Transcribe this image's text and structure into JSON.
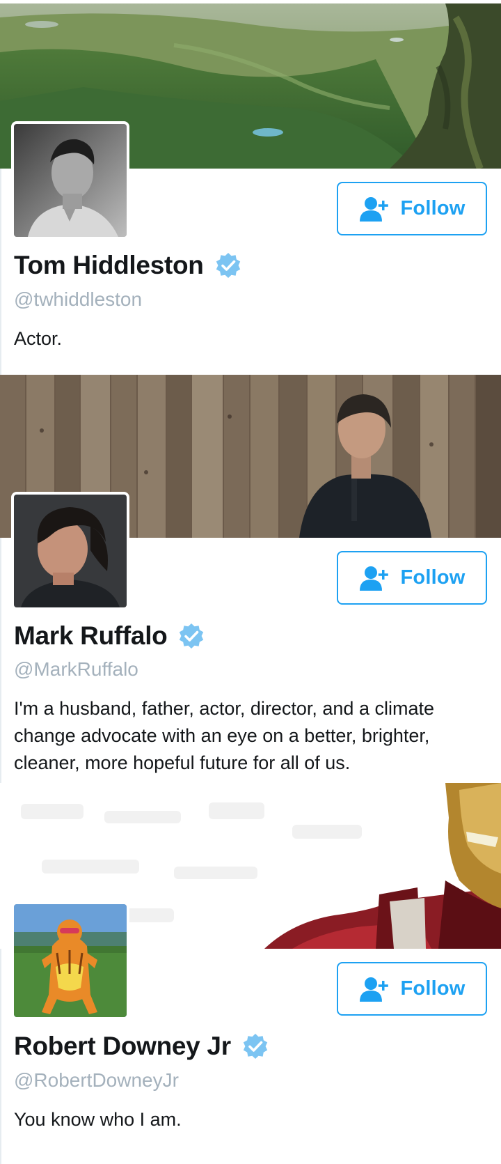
{
  "profiles": [
    {
      "name": "Tom Hiddleston",
      "handle": "@twhiddleston",
      "bio": "Actor.",
      "follow_label": "Follow",
      "verified": true,
      "banner_scene": "green-valley-landscape",
      "avatar_scene": "black-and-white-portrait"
    },
    {
      "name": "Mark Ruffalo",
      "handle": "@MarkRuffalo",
      "bio": "I'm a husband, father, actor, director, and a climate change advocate with an eye on a better, brighter, cleaner, more hopeful future for all of us.",
      "follow_label": "Follow",
      "verified": true,
      "banner_scene": "man-against-wooden-fence",
      "avatar_scene": "color-portrait"
    },
    {
      "name": "Robert Downey Jr",
      "handle": "@RobertDowneyJr",
      "bio": "You know who I am.",
      "follow_label": "Follow",
      "verified": true,
      "banner_scene": "red-and-gold-armored-suit",
      "avatar_scene": "person-in-orange-tiger-costume"
    }
  ],
  "colors": {
    "accent": "#1da1f2",
    "verified_badge": "#7cc4f2",
    "handle_text": "#a4b1bc",
    "name_text": "#14171a"
  }
}
